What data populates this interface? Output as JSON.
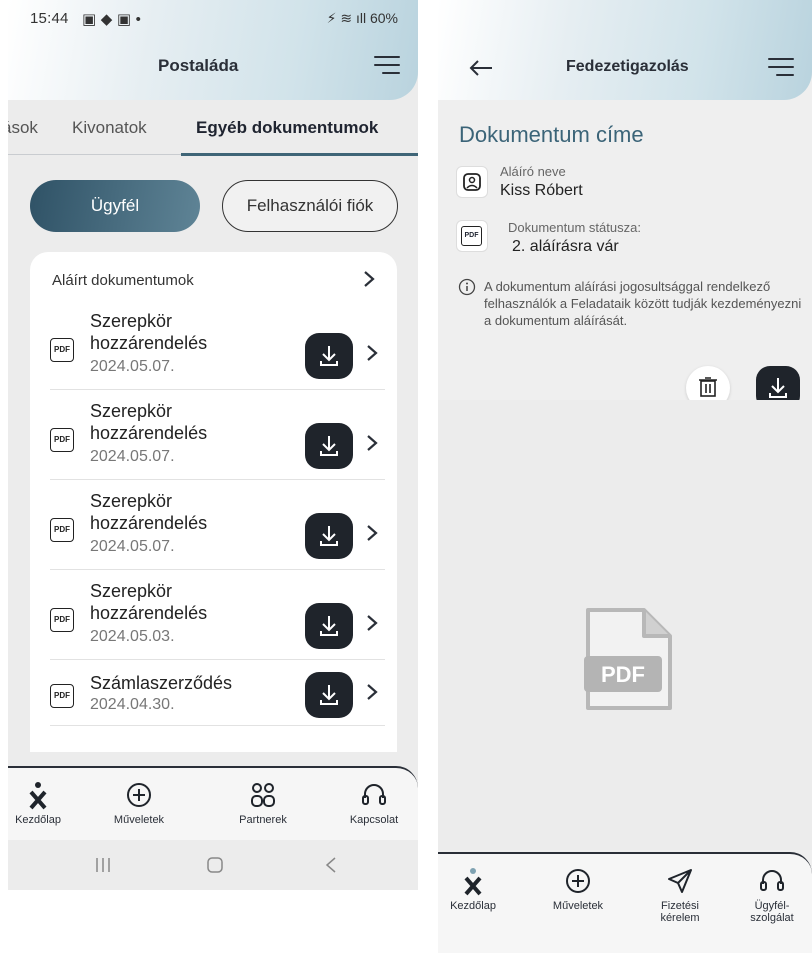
{
  "left": {
    "status_time": "15:44",
    "status_right": "60%",
    "title": "Postaláda",
    "tabs": [
      "ások",
      "Kivonatok",
      "Egyéb dokumentumok"
    ],
    "segment": {
      "active": "Ügyfél",
      "inactive": "Felhasználói fiók"
    },
    "card_header": "Aláírt dokumentumok",
    "documents": [
      {
        "title": "Szerepkör hozzárendelés",
        "date": "2024.05.07."
      },
      {
        "title": "Szerepkör hozzárendelés",
        "date": "2024.05.07."
      },
      {
        "title": "Szerepkör hozzárendelés",
        "date": "2024.05.07."
      },
      {
        "title": "Szerepkör hozzárendelés",
        "date": "2024.05.03."
      },
      {
        "title": "Számlaszerződés",
        "date": "2024.04.30."
      }
    ],
    "pdf_label": "PDF",
    "nav": [
      "Kezdőlap",
      "Műveletek",
      "Partnerek",
      "Kapcsolat"
    ]
  },
  "right": {
    "title": "Fedezetigazolás",
    "doc_title": "Dokumentum címe",
    "signer_label": "Aláíró neve",
    "signer_value": "Kiss Róbert",
    "status_label": "Dokumentum státusza:",
    "status_value": "2. aláírásra vár",
    "note": "A dokumentum aláírási jogosultsággal rendelkező felhasználók a Feladataik között tudják kezdeményezni a dokumentum aláírását.",
    "preview_label": "PDF",
    "pdf_label": "PDF",
    "nav": [
      "Kezdőlap",
      "Műveletek",
      "Fizetési kérelem",
      "Ügyfél-szolgálat"
    ]
  },
  "colors": {
    "accent": "#3b6478",
    "dark_button": "#1f242b"
  }
}
